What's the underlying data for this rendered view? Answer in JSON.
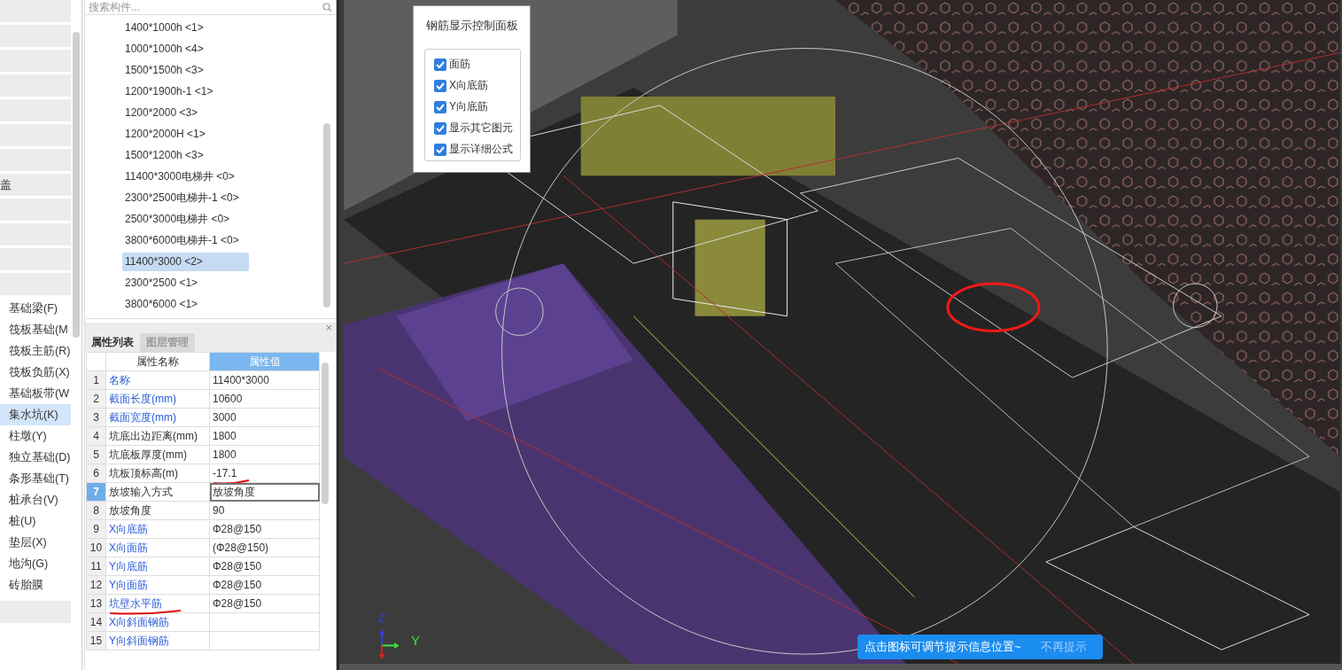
{
  "sidebar": {
    "items": [
      {
        "kind": "group"
      },
      {
        "kind": "group"
      },
      {
        "kind": "group"
      },
      {
        "kind": "group"
      },
      {
        "kind": "group"
      },
      {
        "kind": "group"
      },
      {
        "kind": "group"
      },
      {
        "kind": "group",
        "label": "盖"
      },
      {
        "kind": "group"
      },
      {
        "kind": "group"
      },
      {
        "kind": "group"
      },
      {
        "kind": "group"
      },
      {
        "kind": "item",
        "label": "基础梁(F)",
        "selected": false
      },
      {
        "kind": "item",
        "label": "筏板基础(M",
        "selected": false
      },
      {
        "kind": "item",
        "label": "筏板主筋(R)",
        "selected": false
      },
      {
        "kind": "item",
        "label": "筏板负筋(X)",
        "selected": false
      },
      {
        "kind": "item",
        "label": "基础板带(W",
        "selected": false
      },
      {
        "kind": "item",
        "label": "集水坑(K)",
        "selected": true
      },
      {
        "kind": "item",
        "label": "柱墩(Y)",
        "selected": false
      },
      {
        "kind": "item",
        "label": "独立基础(D)",
        "selected": false
      },
      {
        "kind": "item",
        "label": "条形基础(T)",
        "selected": false
      },
      {
        "kind": "item",
        "label": "桩承台(V)",
        "selected": false
      },
      {
        "kind": "item",
        "label": "桩(U)",
        "selected": false
      },
      {
        "kind": "item",
        "label": "垫层(X)",
        "selected": false
      },
      {
        "kind": "item",
        "label": "地沟(G)",
        "selected": false
      },
      {
        "kind": "item",
        "label": "砖胎膜",
        "selected": false
      },
      {
        "kind": "group"
      }
    ]
  },
  "component_list": {
    "search": {
      "placeholder": "搜索构件..."
    },
    "items": [
      {
        "label": "1400*1000h <1>",
        "selected": false
      },
      {
        "label": "1000*1000h <4>",
        "selected": false
      },
      {
        "label": "1500*1500h <3>",
        "selected": false
      },
      {
        "label": "1200*1900h-1 <1>",
        "selected": false
      },
      {
        "label": "1200*2000 <3>",
        "selected": false
      },
      {
        "label": "1200*2000H <1>",
        "selected": false
      },
      {
        "label": "1500*1200h <3>",
        "selected": false
      },
      {
        "label": "11400*3000电梯井 <0>",
        "selected": false
      },
      {
        "label": "2300*2500电梯井-1 <0>",
        "selected": false
      },
      {
        "label": "2500*3000电梯井 <0>",
        "selected": false
      },
      {
        "label": "3800*6000电梯井-1 <0>",
        "selected": false
      },
      {
        "label": "11400*3000 <2>",
        "selected": true
      },
      {
        "label": "2300*2500 <1>",
        "selected": false
      },
      {
        "label": "3800*6000 <1>",
        "selected": false
      }
    ]
  },
  "properties": {
    "close": "×",
    "tabs": [
      {
        "label": "属性列表",
        "selected": true
      },
      {
        "label": "图层管理",
        "selected": false
      }
    ],
    "columns": [
      {
        "label": "属性名称",
        "selected": false
      },
      {
        "label": "属性值",
        "selected": true
      }
    ],
    "rows": [
      {
        "index": "1",
        "name": "名称",
        "value": "11400*3000",
        "public": true,
        "selected": false
      },
      {
        "index": "2",
        "name": "截面长度(mm)",
        "value": "10600",
        "public": true,
        "selected": false
      },
      {
        "index": "3",
        "name": "截面宽度(mm)",
        "value": "3000",
        "public": true,
        "selected": false
      },
      {
        "index": "4",
        "name": "坑底出边距离(mm)",
        "value": "1800",
        "public": false,
        "selected": false
      },
      {
        "index": "5",
        "name": "坑底板厚度(mm)",
        "value": "1800",
        "public": false,
        "selected": false
      },
      {
        "index": "6",
        "name": "坑板顶标高(m)",
        "value": "-17.1",
        "public": false,
        "selected": false,
        "value_marked": true
      },
      {
        "index": "7",
        "name": "放坡输入方式",
        "value": "放坡角度",
        "public": false,
        "selected": true
      },
      {
        "index": "8",
        "name": "放坡角度",
        "value": "90",
        "public": false,
        "selected": false
      },
      {
        "index": "9",
        "name": "X向底筋",
        "value": "Φ28@150",
        "public": true,
        "selected": false
      },
      {
        "index": "10",
        "name": "X向面筋",
        "value": "(Φ28@150)",
        "public": true,
        "selected": false
      },
      {
        "index": "11",
        "name": "Y向底筋",
        "value": "Φ28@150",
        "public": true,
        "selected": false
      },
      {
        "index": "12",
        "name": "Y向面筋",
        "value": "Φ28@150",
        "public": true,
        "selected": false
      },
      {
        "index": "13",
        "name": "坑壁水平筋",
        "value": "Φ28@150",
        "public": true,
        "selected": false,
        "name_marked": true
      },
      {
        "index": "14",
        "name": "X向斜面钢筋",
        "public": true,
        "selected": false
      },
      {
        "index": "15",
        "name": "Y向斜面钢筋",
        "public": true,
        "selected": false
      }
    ]
  },
  "rebar_panel": {
    "title": "钢筋显示控制面板",
    "options": [
      {
        "label": "面筋",
        "checked": true
      },
      {
        "label": "X向底筋",
        "checked": true
      },
      {
        "label": "Y向底筋",
        "checked": true
      },
      {
        "label": "显示其它图元",
        "checked": true
      },
      {
        "label": "显示详细公式",
        "checked": true
      }
    ]
  },
  "viewport": {
    "axis": {
      "z": "Z",
      "y": "Y"
    }
  },
  "tip": {
    "message": "点击图标可调节提示信息位置~",
    "dismiss": "不再提示"
  }
}
